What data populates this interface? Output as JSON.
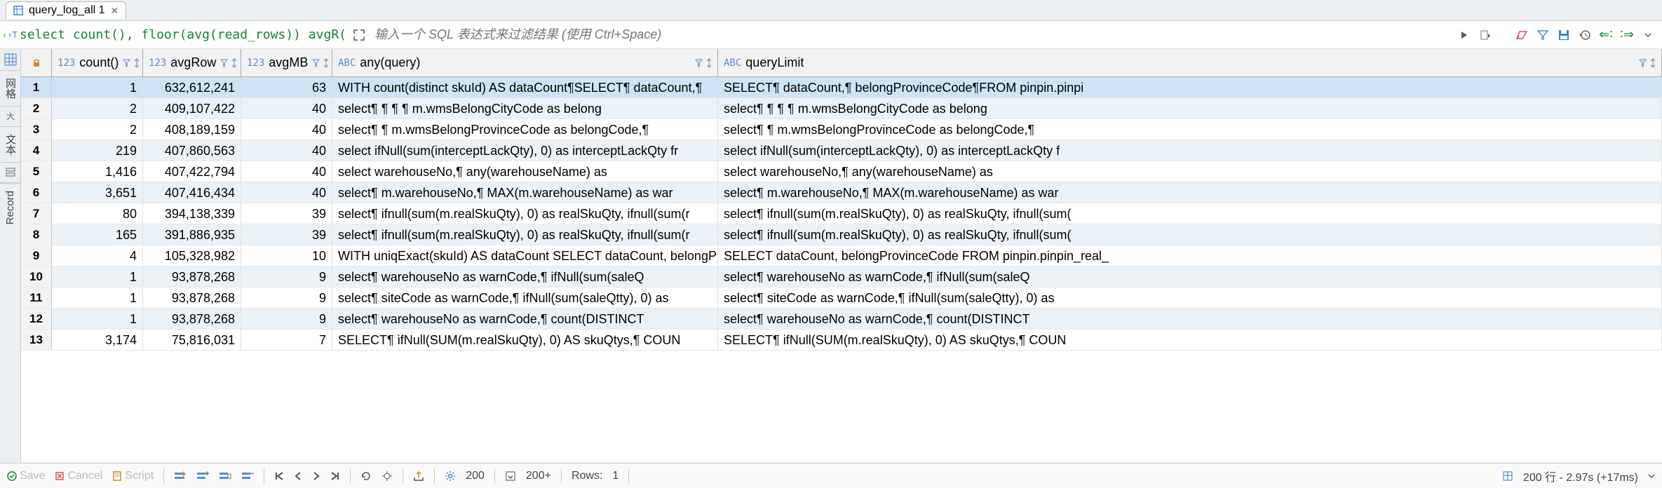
{
  "tab": {
    "title": "query_log_all 1"
  },
  "sql_preview": "select count(),     floor(avg(read_rows)) avgR(",
  "filter_placeholder": "输入一个 SQL 表达式来过滤结果 (使用 Ctrl+Space)",
  "columns": [
    {
      "type": "123",
      "name": "count()"
    },
    {
      "type": "123",
      "name": "avgRow"
    },
    {
      "type": "123",
      "name": "avgMB"
    },
    {
      "type": "ABC",
      "name": "any(query)"
    },
    {
      "type": "ABC",
      "name": "queryLimit"
    }
  ],
  "rows": [
    {
      "n": 1,
      "count": "1",
      "avgRow": "632,612,241",
      "avgMB": "63",
      "anyQuery": "WITH count(distinct skuId) AS dataCount¶SELECT¶    dataCount,¶",
      "queryLimit": "SELECT¶    dataCount,¶     belongProvinceCode¶FROM pinpin.pinpi"
    },
    {
      "n": 2,
      "count": "2",
      "avgRow": "409,107,422",
      "avgMB": "40",
      "anyQuery": "select¶        ¶        ¶        ¶            m.wmsBelongCityCode as belong",
      "queryLimit": "select¶        ¶        ¶        ¶            m.wmsBelongCityCode as belong"
    },
    {
      "n": 3,
      "count": "2",
      "avgRow": "408,189,159",
      "avgMB": "40",
      "anyQuery": "select¶        ¶            m.wmsBelongProvinceCode as belongCode,¶",
      "queryLimit": "select¶        ¶            m.wmsBelongProvinceCode as belongCode,¶"
    },
    {
      "n": 4,
      "count": "219",
      "avgRow": "407,860,563",
      "avgMB": "40",
      "anyQuery": "select ifNull(sum(interceptLackQty), 0) as interceptLackQty        fr",
      "queryLimit": "select ifNull(sum(interceptLackQty), 0) as interceptLackQty        f"
    },
    {
      "n": 5,
      "count": "1,416",
      "avgRow": "407,422,794",
      "avgMB": "40",
      "anyQuery": "select warehouseNo,¶            any(warehouseName)                   as",
      "queryLimit": "select warehouseNo,¶            any(warehouseName)                   as"
    },
    {
      "n": 6,
      "count": "3,651",
      "avgRow": "407,416,434",
      "avgMB": "40",
      "anyQuery": "select¶      m.warehouseNo,¶       MAX(m.warehouseName) as war",
      "queryLimit": "select¶      m.warehouseNo,¶       MAX(m.warehouseName) as war"
    },
    {
      "n": 7,
      "count": "80",
      "avgRow": "394,138,339",
      "avgMB": "39",
      "anyQuery": "select¶      ifnull(sum(m.realSkuQty), 0) as realSkuQty, ifnull(sum(r",
      "queryLimit": "select¶      ifnull(sum(m.realSkuQty), 0) as realSkuQty, ifnull(sum("
    },
    {
      "n": 8,
      "count": "165",
      "avgRow": "391,886,935",
      "avgMB": "39",
      "anyQuery": "select¶      ifnull(sum(m.realSkuQty), 0) as realSkuQty, ifnull(sum(r",
      "queryLimit": "select¶      ifnull(sum(m.realSkuQty), 0) as realSkuQty, ifnull(sum("
    },
    {
      "n": 9,
      "count": "4",
      "avgRow": "105,328,982",
      "avgMB": "10",
      "anyQuery": "WITH uniqExact(skuId) AS dataCount SELECT dataCount, belongPr",
      "queryLimit": "SELECT dataCount, belongProvinceCode FROM pinpin.pinpin_real_"
    },
    {
      "n": 10,
      "count": "1",
      "avgRow": "93,878,268",
      "avgMB": "9",
      "anyQuery": "select¶         warehouseNo as warnCode,¶         ifNull(sum(saleQ",
      "queryLimit": "select¶         warehouseNo as warnCode,¶         ifNull(sum(saleQ"
    },
    {
      "n": 11,
      "count": "1",
      "avgRow": "93,878,268",
      "avgMB": "9",
      "anyQuery": "select¶       siteCode as warnCode,¶       ifNull(sum(saleQtty), 0) as",
      "queryLimit": "select¶       siteCode as warnCode,¶       ifNull(sum(saleQtty), 0) as"
    },
    {
      "n": 12,
      "count": "1",
      "avgRow": "93,878,268",
      "avgMB": "9",
      "anyQuery": "select¶         warehouseNo as warnCode,¶         count(DISTINCT",
      "queryLimit": "select¶         warehouseNo as warnCode,¶         count(DISTINCT"
    },
    {
      "n": 13,
      "count": "3,174",
      "avgRow": "75,816,031",
      "avgMB": "7",
      "anyQuery": "SELECT¶     ifNull(SUM(m.realSkuQty), 0) AS skuQtys,¶         COUN",
      "queryLimit": "SELECT¶     ifNull(SUM(m.realSkuQty), 0) AS skuQtys,¶         COUN"
    }
  ],
  "sidebar": {
    "tab1": "网格",
    "tab2": "文本",
    "tab3": "Record"
  },
  "status": {
    "save": "Save",
    "cancel": "Cancel",
    "script": "Script",
    "fetch_size": "200",
    "fetched": "200+",
    "rows_label": "Rows:",
    "rows_value": "1",
    "summary": "200 行 - 2.97s (+17ms)"
  }
}
